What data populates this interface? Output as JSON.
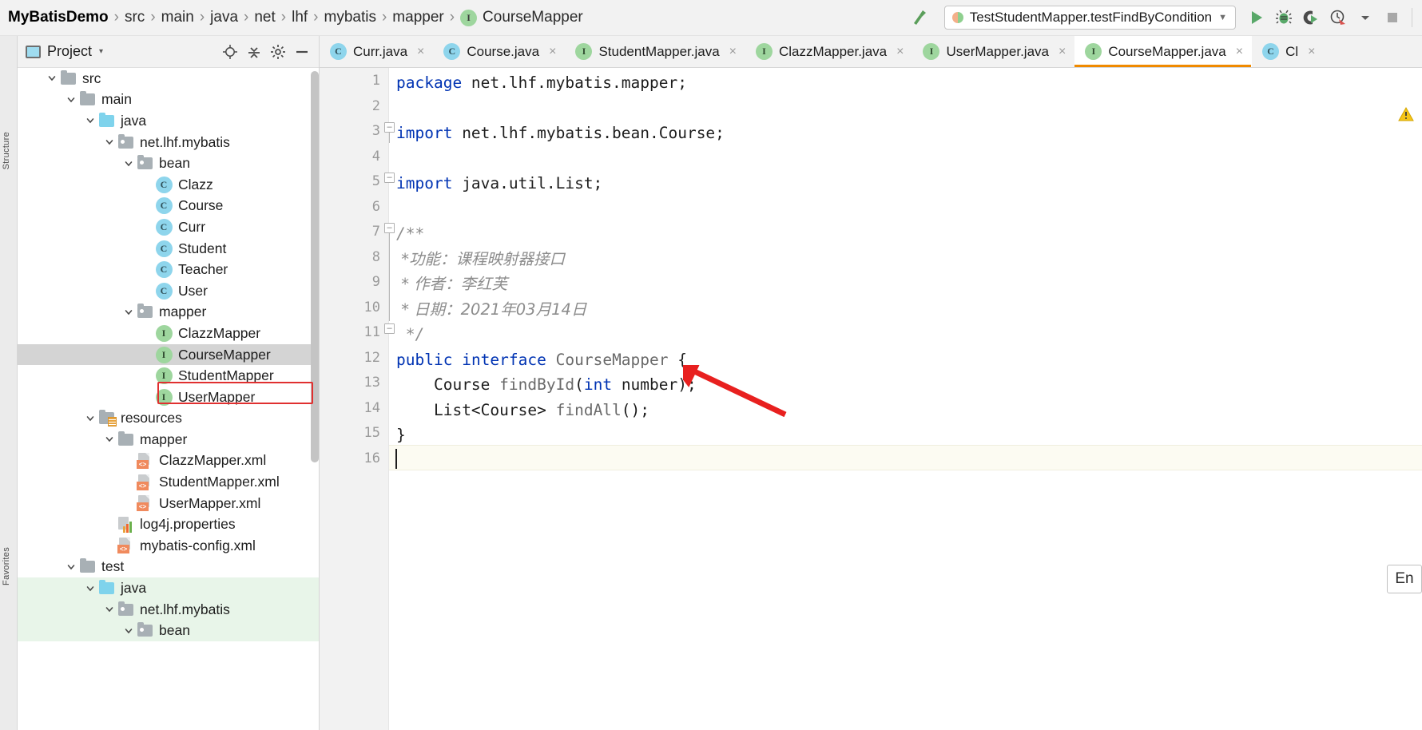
{
  "breadcrumb": {
    "separator": "›",
    "items": [
      {
        "label": "MyBatisDemo",
        "type": "project"
      },
      {
        "label": "src",
        "type": "folder"
      },
      {
        "label": "main",
        "type": "folder"
      },
      {
        "label": "java",
        "type": "folder"
      },
      {
        "label": "net",
        "type": "folder"
      },
      {
        "label": "lhf",
        "type": "folder"
      },
      {
        "label": "mybatis",
        "type": "folder"
      },
      {
        "label": "mapper",
        "type": "folder"
      },
      {
        "label": "CourseMapper",
        "type": "interface",
        "badge": "I"
      }
    ]
  },
  "toolbar": {
    "build_icon": "hammer-icon",
    "run_config": {
      "label": "TestStudentMapper.testFindByCondition",
      "arrow": "▼"
    },
    "actions": [
      {
        "name": "run-button",
        "icon": "run-icon"
      },
      {
        "name": "debug-button",
        "icon": "debug-icon"
      },
      {
        "name": "run-with-coverage-button",
        "icon": "coverage-icon"
      },
      {
        "name": "profiler-button",
        "icon": "profiler-icon"
      },
      {
        "name": "profiler-dropdown",
        "icon": "chevron-down-icon"
      },
      {
        "name": "stop-button",
        "icon": "stop-icon"
      }
    ]
  },
  "project_panel": {
    "title": "Project",
    "caret": "▾",
    "header_actions": [
      {
        "name": "locate-button",
        "icon": "crosshair-icon"
      },
      {
        "name": "collapse-all-button",
        "icon": "collapse-icon"
      },
      {
        "name": "settings-button",
        "icon": "gear-icon"
      },
      {
        "name": "hide-button",
        "icon": "minimize-icon"
      }
    ],
    "tree": [
      {
        "label": "src",
        "indent": 1,
        "icon": "folder",
        "expanded": true
      },
      {
        "label": "main",
        "indent": 2,
        "icon": "folder",
        "expanded": true
      },
      {
        "label": "java",
        "indent": 3,
        "icon": "folder-source",
        "expanded": true
      },
      {
        "label": "net.lhf.mybatis",
        "indent": 4,
        "icon": "folder-package",
        "expanded": true
      },
      {
        "label": "bean",
        "indent": 5,
        "icon": "folder-package",
        "expanded": true
      },
      {
        "label": "Clazz",
        "indent": 6,
        "icon": "class",
        "badge": "C"
      },
      {
        "label": "Course",
        "indent": 6,
        "icon": "class",
        "badge": "C"
      },
      {
        "label": "Curr",
        "indent": 6,
        "icon": "class",
        "badge": "C"
      },
      {
        "label": "Student",
        "indent": 6,
        "icon": "class",
        "badge": "C"
      },
      {
        "label": "Teacher",
        "indent": 6,
        "icon": "class",
        "badge": "C"
      },
      {
        "label": "User",
        "indent": 6,
        "icon": "class",
        "badge": "C"
      },
      {
        "label": "mapper",
        "indent": 5,
        "icon": "folder-package",
        "expanded": true
      },
      {
        "label": "ClazzMapper",
        "indent": 6,
        "icon": "interface",
        "badge": "I"
      },
      {
        "label": "CourseMapper",
        "indent": 6,
        "icon": "interface",
        "badge": "I",
        "selected": true,
        "annotated": true
      },
      {
        "label": "StudentMapper",
        "indent": 6,
        "icon": "interface",
        "badge": "I"
      },
      {
        "label": "UserMapper",
        "indent": 6,
        "icon": "interface",
        "badge": "I"
      },
      {
        "label": "resources",
        "indent": 3,
        "icon": "folder-resources",
        "expanded": true
      },
      {
        "label": "mapper",
        "indent": 4,
        "icon": "folder",
        "expanded": true
      },
      {
        "label": "ClazzMapper.xml",
        "indent": 5,
        "icon": "xml"
      },
      {
        "label": "StudentMapper.xml",
        "indent": 5,
        "icon": "xml"
      },
      {
        "label": "UserMapper.xml",
        "indent": 5,
        "icon": "xml"
      },
      {
        "label": "log4j.properties",
        "indent": 4,
        "icon": "properties"
      },
      {
        "label": "mybatis-config.xml",
        "indent": 4,
        "icon": "xml"
      },
      {
        "label": "test",
        "indent": 2,
        "icon": "folder",
        "expanded": true
      },
      {
        "label": "java",
        "indent": 3,
        "icon": "folder-test",
        "expanded": true,
        "testsrc": true
      },
      {
        "label": "net.lhf.mybatis",
        "indent": 4,
        "icon": "folder-package",
        "expanded": true,
        "testsrc": true
      },
      {
        "label": "bean",
        "indent": 5,
        "icon": "folder-package",
        "expanded": true,
        "testsrc": true
      }
    ]
  },
  "editor": {
    "tabs": [
      {
        "label": "Curr.java",
        "badge": "C",
        "kind": "class",
        "active": false
      },
      {
        "label": "Course.java",
        "badge": "C",
        "kind": "class",
        "active": false
      },
      {
        "label": "StudentMapper.java",
        "badge": "I",
        "kind": "interface",
        "active": false
      },
      {
        "label": "ClazzMapper.java",
        "badge": "I",
        "kind": "interface",
        "active": false
      },
      {
        "label": "UserMapper.java",
        "badge": "I",
        "kind": "interface",
        "active": false
      },
      {
        "label": "CourseMapper.java",
        "badge": "I",
        "kind": "interface",
        "active": true
      },
      {
        "label": "Cl",
        "badge": "C",
        "kind": "class",
        "active": false
      }
    ],
    "close_glyph": "×",
    "line_numbers": [
      1,
      2,
      3,
      4,
      5,
      6,
      7,
      8,
      9,
      10,
      11,
      12,
      13,
      14,
      15,
      16
    ],
    "caret_line": 16,
    "lines": [
      {
        "n": 1,
        "tokens": [
          {
            "t": "package",
            "c": "k"
          },
          {
            "t": " net.lhf.mybatis.mapper;",
            "c": "pln"
          }
        ]
      },
      {
        "n": 2,
        "tokens": []
      },
      {
        "n": 3,
        "tokens": [
          {
            "t": "import",
            "c": "k"
          },
          {
            "t": " net.lhf.mybatis.bean.Course;",
            "c": "pln"
          }
        ]
      },
      {
        "n": 4,
        "tokens": []
      },
      {
        "n": 5,
        "tokens": [
          {
            "t": "import",
            "c": "k"
          },
          {
            "t": " java.util.List;",
            "c": "pln"
          }
        ]
      },
      {
        "n": 6,
        "tokens": []
      },
      {
        "n": 7,
        "tokens": [
          {
            "t": "/**",
            "c": "cm-mono"
          }
        ]
      },
      {
        "n": 8,
        "tokens": [
          {
            "t": " *功能：课程映射器接口",
            "c": "cm"
          }
        ]
      },
      {
        "n": 9,
        "tokens": [
          {
            "t": " * 作者：李红芙",
            "c": "cm"
          }
        ]
      },
      {
        "n": 10,
        "tokens": [
          {
            "t": " * 日期：2021年03月14日",
            "c": "cm"
          }
        ]
      },
      {
        "n": 11,
        "tokens": [
          {
            "t": " */",
            "c": "cm-mono"
          }
        ]
      },
      {
        "n": 12,
        "tokens": [
          {
            "t": "public",
            "c": "k"
          },
          {
            "t": " ",
            "c": "pln"
          },
          {
            "t": "interface",
            "c": "k"
          },
          {
            "t": " ",
            "c": "pln"
          },
          {
            "t": "CourseMapper",
            "c": "mth"
          },
          {
            "t": " {",
            "c": "pln"
          }
        ]
      },
      {
        "n": 13,
        "tokens": [
          {
            "t": "    ",
            "c": "pln"
          },
          {
            "t": "Course",
            "c": "ty"
          },
          {
            "t": " ",
            "c": "pln"
          },
          {
            "t": "findById",
            "c": "mth"
          },
          {
            "t": "(",
            "c": "pln"
          },
          {
            "t": "int",
            "c": "k"
          },
          {
            "t": " number);",
            "c": "pln"
          }
        ]
      },
      {
        "n": 14,
        "tokens": [
          {
            "t": "    ",
            "c": "pln"
          },
          {
            "t": "List<Course>",
            "c": "ty"
          },
          {
            "t": " ",
            "c": "pln"
          },
          {
            "t": "findAll",
            "c": "mth"
          },
          {
            "t": "();",
            "c": "pln"
          }
        ]
      },
      {
        "n": 15,
        "tokens": [
          {
            "t": "}",
            "c": "pln"
          }
        ]
      },
      {
        "n": 16,
        "tokens": []
      }
    ],
    "warning_icon": "warning-triangle-icon"
  },
  "ime_indicator": {
    "label": "En"
  },
  "left_stripe": {
    "labels": [
      "Structure",
      "Favorites"
    ]
  },
  "colors": {
    "keyword": "#0033b3",
    "comment": "#8c8c8c",
    "method": "#6a6a6a",
    "tab_active_underline": "#f08a00",
    "annotation_red": "#e03030",
    "class_badge": "#8ed5ec",
    "interface_badge": "#9ed69e",
    "test_source_bg": "#e8f5e9",
    "selection_bg": "#d4d4d4",
    "caret_line_bg": "#fcfbf2",
    "panel_bg": "#f2f2f2",
    "source_folder": "#7fd3ec"
  }
}
